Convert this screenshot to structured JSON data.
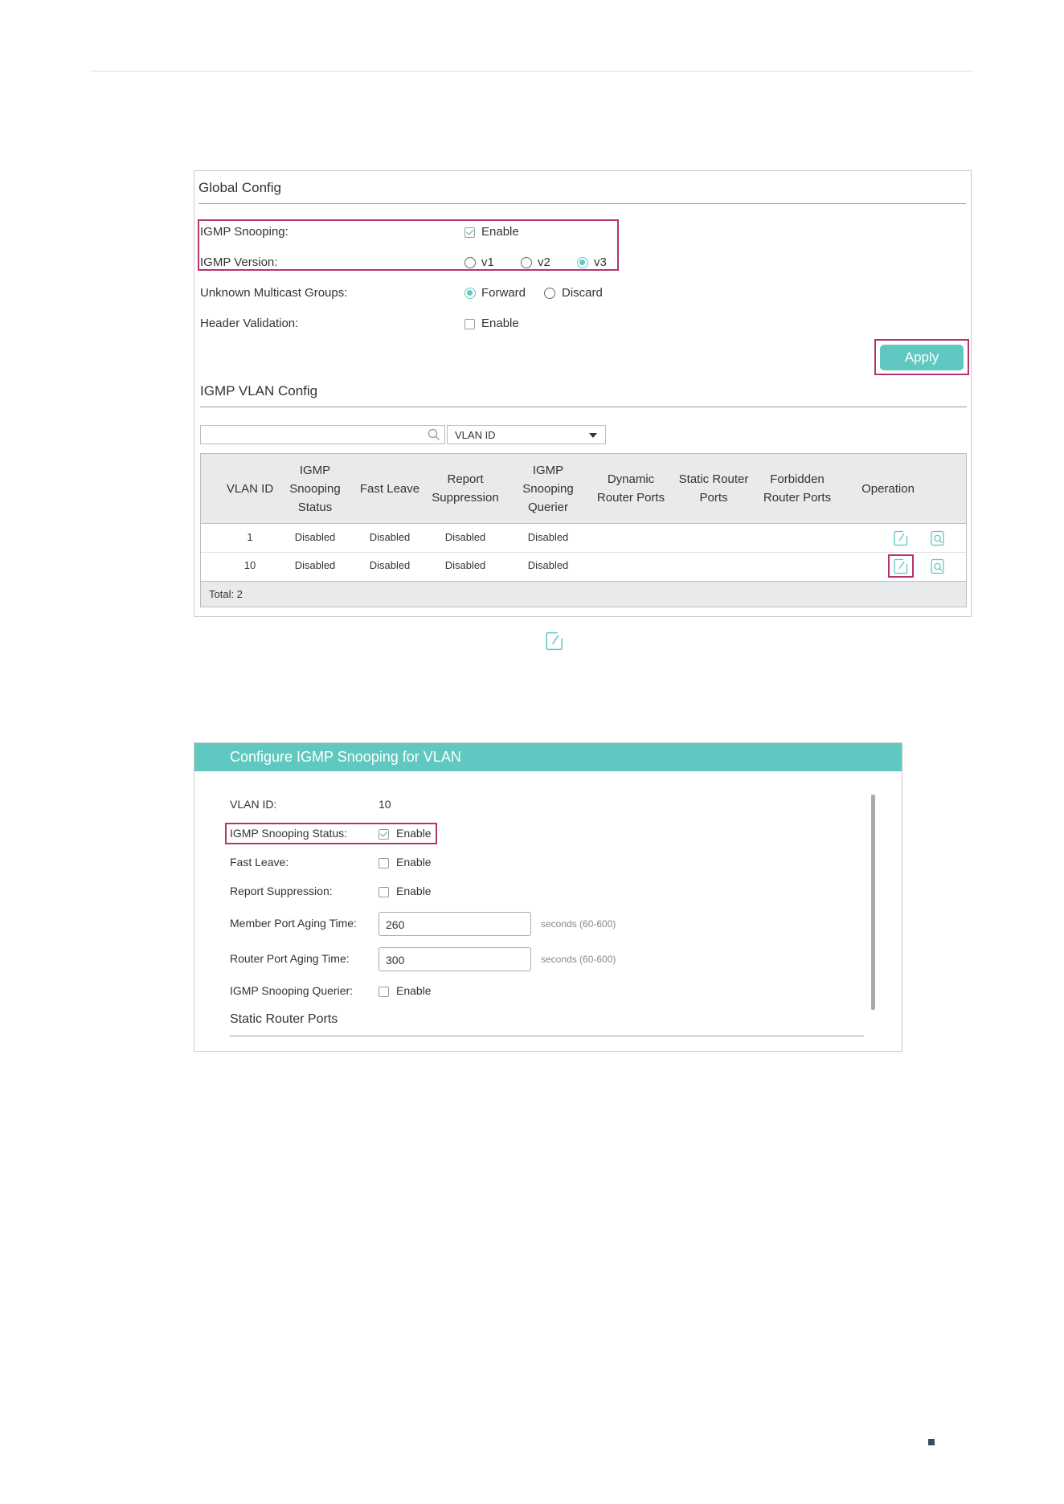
{
  "global_config": {
    "title": "Global Config",
    "igmp_snooping_label": "IGMP Snooping:",
    "igmp_snooping_option": "Enable",
    "igmp_version_label": "IGMP Version:",
    "igmp_version_options": [
      "v1",
      "v2",
      "v3"
    ],
    "igmp_version_selected": "v3",
    "unknown_multicast_label": "Unknown Multicast Groups:",
    "unknown_multicast_options": [
      "Forward",
      "Discard"
    ],
    "unknown_multicast_selected": "Forward",
    "header_validation_label": "Header Validation:",
    "header_validation_option": "Enable",
    "apply_label": "Apply"
  },
  "vlan_config": {
    "title": "IGMP VLAN Config",
    "search_placeholder": "",
    "search_field": "VLAN ID",
    "columns": [
      "VLAN ID",
      "IGMP Snooping Status",
      "Fast Leave",
      "Report Suppression",
      "IGMP Snooping Querier",
      "Dynamic Router Ports",
      "Static Router Ports",
      "Forbidden Router Ports",
      "Operation"
    ],
    "rows": [
      {
        "vlan_id": "1",
        "snooping_status": "Disabled",
        "fast_leave": "Disabled",
        "report_suppression": "Disabled",
        "querier": "Disabled",
        "dynamic_ports": "",
        "static_ports": "",
        "forbidden_ports": ""
      },
      {
        "vlan_id": "10",
        "snooping_status": "Disabled",
        "fast_leave": "Disabled",
        "report_suppression": "Disabled",
        "querier": "Disabled",
        "dynamic_ports": "",
        "static_ports": "",
        "forbidden_ports": ""
      }
    ],
    "total": "Total: 2"
  },
  "dialog": {
    "title": "Configure IGMP Snooping for VLAN",
    "vlan_id_label": "VLAN ID:",
    "vlan_id_value": "10",
    "snooping_status_label": "IGMP Snooping Status:",
    "snooping_status_option": "Enable",
    "fast_leave_label": "Fast Leave:",
    "fast_leave_option": "Enable",
    "report_suppression_label": "Report Suppression:",
    "report_suppression_option": "Enable",
    "member_aging_label": "Member Port Aging Time:",
    "member_aging_value": "260",
    "member_aging_hint": "seconds (60-600)",
    "router_aging_label": "Router Port Aging Time:",
    "router_aging_value": "300",
    "router_aging_hint": "seconds (60-600)",
    "querier_label": "IGMP Snooping Querier:",
    "querier_option": "Enable",
    "static_ports_title": "Static Router Ports"
  },
  "colors": {
    "accent": "#5fc8c0",
    "highlight": "#b5336f",
    "footer_mark": "#3a4f5c"
  }
}
